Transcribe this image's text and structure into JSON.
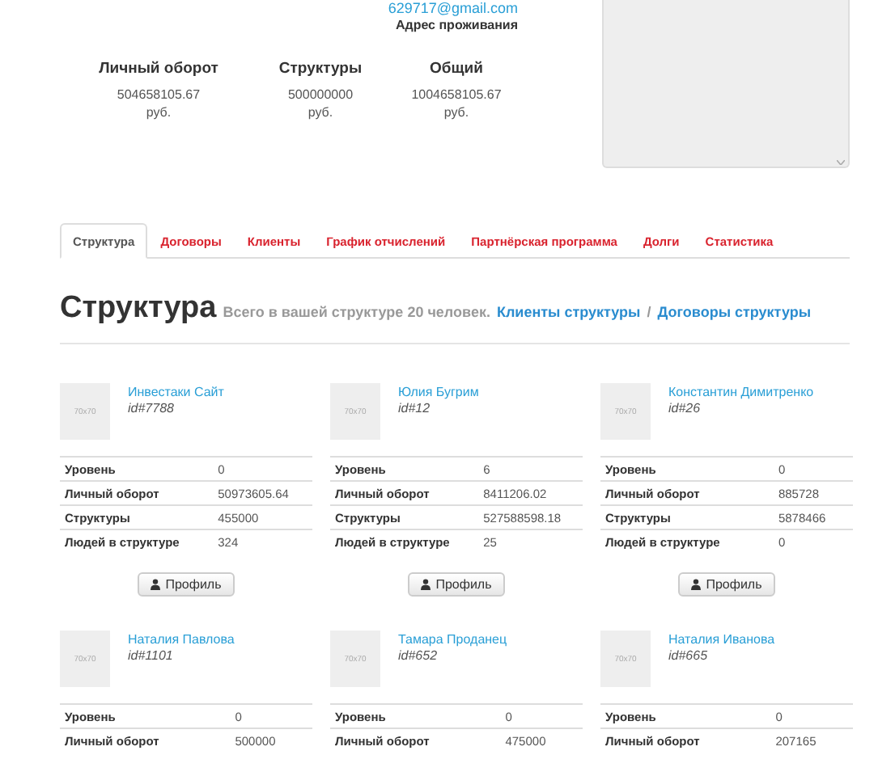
{
  "profile": {
    "email": "629717@gmail.com",
    "address_label": "Адрес проживания"
  },
  "totals": [
    {
      "label": "Личный оборот",
      "value": "504658105.67",
      "unit": "руб."
    },
    {
      "label": "Структуры",
      "value": "500000000",
      "unit": "руб."
    },
    {
      "label": "Общий",
      "value": "1004658105.67",
      "unit": "руб."
    }
  ],
  "tabs": [
    {
      "label": "Структура",
      "selected": true
    },
    {
      "label": "Договоры",
      "selected": false
    },
    {
      "label": "Клиенты",
      "selected": false
    },
    {
      "label": "График отчислений",
      "selected": false
    },
    {
      "label": "Партнёрская программа",
      "selected": false
    },
    {
      "label": "Долги",
      "selected": false
    },
    {
      "label": "Статистика",
      "selected": false
    }
  ],
  "heading": {
    "title": "Структура",
    "summary": "Всего в вашей структуре 20 человек.",
    "link_clients": "Клиенты структуры",
    "separator": "/",
    "link_contracts": "Договоры структуры"
  },
  "members": [
    {
      "avatar_label": "70x70",
      "name": "Инвестаки Сайт",
      "id": "id#7788",
      "rows": [
        {
          "label": "Уровень",
          "value": "0"
        },
        {
          "label": "Личный оборот",
          "value": "50973605.64"
        },
        {
          "label": "Структуры",
          "value": "455000"
        },
        {
          "label": "Людей в структуре",
          "value": "324"
        }
      ],
      "button": "Профиль"
    },
    {
      "avatar_label": "70x70",
      "name": "Юлия Бугрим",
      "id": "id#12",
      "rows": [
        {
          "label": "Уровень",
          "value": "6"
        },
        {
          "label": "Личный оборот",
          "value": "8411206.02"
        },
        {
          "label": "Структуры",
          "value": "527588598.18"
        },
        {
          "label": "Людей в структуре",
          "value": "25"
        }
      ],
      "button": "Профиль"
    },
    {
      "avatar_label": "70x70",
      "name": "Константин Димитренко",
      "id": "id#26",
      "rows": [
        {
          "label": "Уровень",
          "value": "0"
        },
        {
          "label": "Личный оборот",
          "value": "885728"
        },
        {
          "label": "Структуры",
          "value": "5878466"
        },
        {
          "label": "Людей в структуре",
          "value": "0"
        }
      ],
      "button": "Профиль"
    },
    {
      "avatar_label": "70x70",
      "name": "Наталия Павлова",
      "id": "id#1101",
      "rows": [
        {
          "label": "Уровень",
          "value": "0"
        },
        {
          "label": "Личный оборот",
          "value": "500000"
        }
      ]
    },
    {
      "avatar_label": "70x70",
      "name": "Тамара Проданец",
      "id": "id#652",
      "rows": [
        {
          "label": "Уровень",
          "value": "0"
        },
        {
          "label": "Личный оборот",
          "value": "475000"
        }
      ]
    },
    {
      "avatar_label": "70x70",
      "name": "Наталия Иванова",
      "id": "id#665",
      "rows": [
        {
          "label": "Уровень",
          "value": "0"
        },
        {
          "label": "Личный оборот",
          "value": "207165"
        }
      ]
    }
  ]
}
